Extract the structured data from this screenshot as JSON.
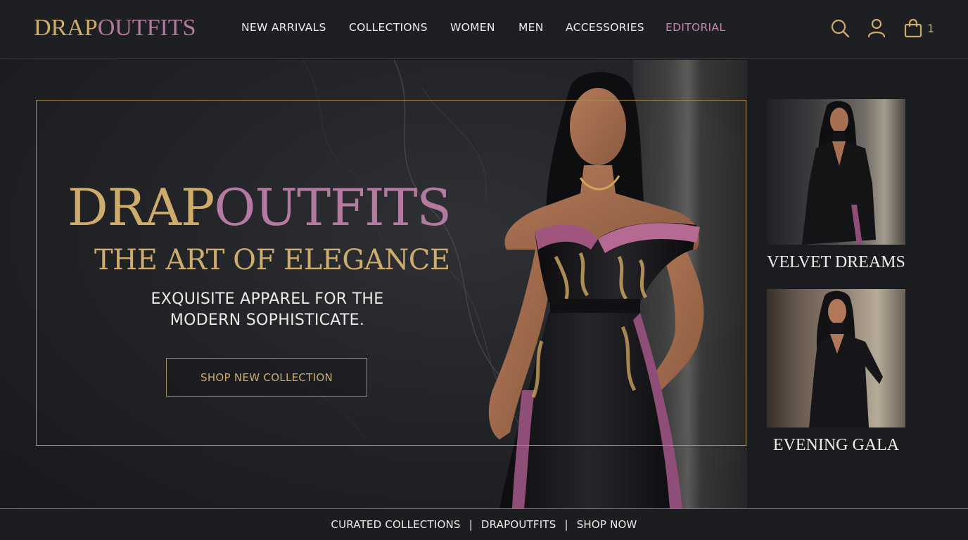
{
  "brand": {
    "part1": "DRAP",
    "part2": "OUTFITS"
  },
  "colors": {
    "gold": "#cfac6c",
    "mauve": "#b47aa2",
    "background": "#1b1d21"
  },
  "nav": {
    "items": [
      {
        "label": "NEW ARRIVALS",
        "active": false
      },
      {
        "label": "COLLECTIONS",
        "active": false
      },
      {
        "label": "WOMEN",
        "active": false
      },
      {
        "label": "MEN",
        "active": false
      },
      {
        "label": "ACCESSORIES",
        "active": false
      },
      {
        "label": "EDITORIAL",
        "active": true
      }
    ]
  },
  "header_icons": {
    "search": "search-icon",
    "account": "user-icon",
    "cart": "shopping-bag-icon"
  },
  "cart": {
    "count": "1"
  },
  "hero": {
    "title_part1": "DRAP",
    "title_part2": "OUTFITS",
    "subtitle": "THE ART OF ELEGANCE",
    "description_line1": "EXQUISITE APPAREL FOR THE",
    "description_line2": "MODERN SOPHISTICATE.",
    "cta_label": "SHOP NEW COLLECTION"
  },
  "side_collections": [
    {
      "label": "VELVET DREAMS"
    },
    {
      "label": "EVENING GALA"
    }
  ],
  "footer": {
    "items": [
      "CURATED COLLECTIONS",
      "DRAPOUTFITS",
      "SHOP NOW"
    ],
    "separator": "|"
  }
}
